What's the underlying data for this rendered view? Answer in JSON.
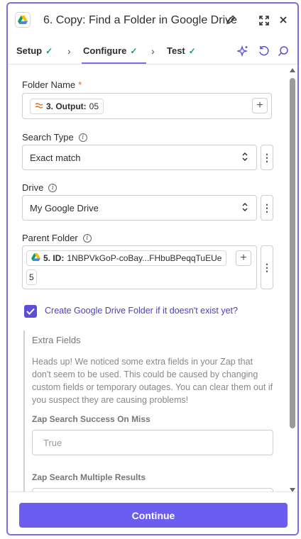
{
  "header": {
    "title": "6. Copy: Find a Folder in Google Drive",
    "app_icon": "google-drive-icon"
  },
  "tabs": [
    {
      "label": "Setup",
      "done": true
    },
    {
      "label": "Configure",
      "done": true,
      "active": true
    },
    {
      "label": "Test",
      "done": true
    }
  ],
  "fields": {
    "folder_name": {
      "label": "Folder Name",
      "required_mark": "*",
      "pill_step": "3. Output:",
      "pill_value": "05"
    },
    "search_type": {
      "label": "Search Type",
      "value": "Exact match"
    },
    "drive": {
      "label": "Drive",
      "value": "My Google Drive"
    },
    "parent_folder": {
      "label": "Parent Folder",
      "pill_step": "5. ID:",
      "pill_value": "1NBPVkGoP-coBay...FHbuBPeqqTuEUe",
      "overflow_value": "5"
    }
  },
  "create_folder": {
    "checked": true,
    "label": "Create Google Drive Folder if it doesn't exist yet?"
  },
  "extra_fields": {
    "title": "Extra Fields",
    "text": "Heads up! We noticed some extra fields in your Zap that don't seem to be used. This could be caused by changing custom fields or temporary outages. You can clear them out if you suspect they are causing problems!",
    "success_on_miss": {
      "label": "Zap Search Success On Miss",
      "placeholder": "True"
    },
    "multiple_results": {
      "label": "Zap Search Multiple Results"
    }
  },
  "footer": {
    "continue_label": "Continue"
  },
  "colors": {
    "accent": "#6a5df0",
    "check_green": "#1e9e5c",
    "required": "#e06a1b"
  }
}
